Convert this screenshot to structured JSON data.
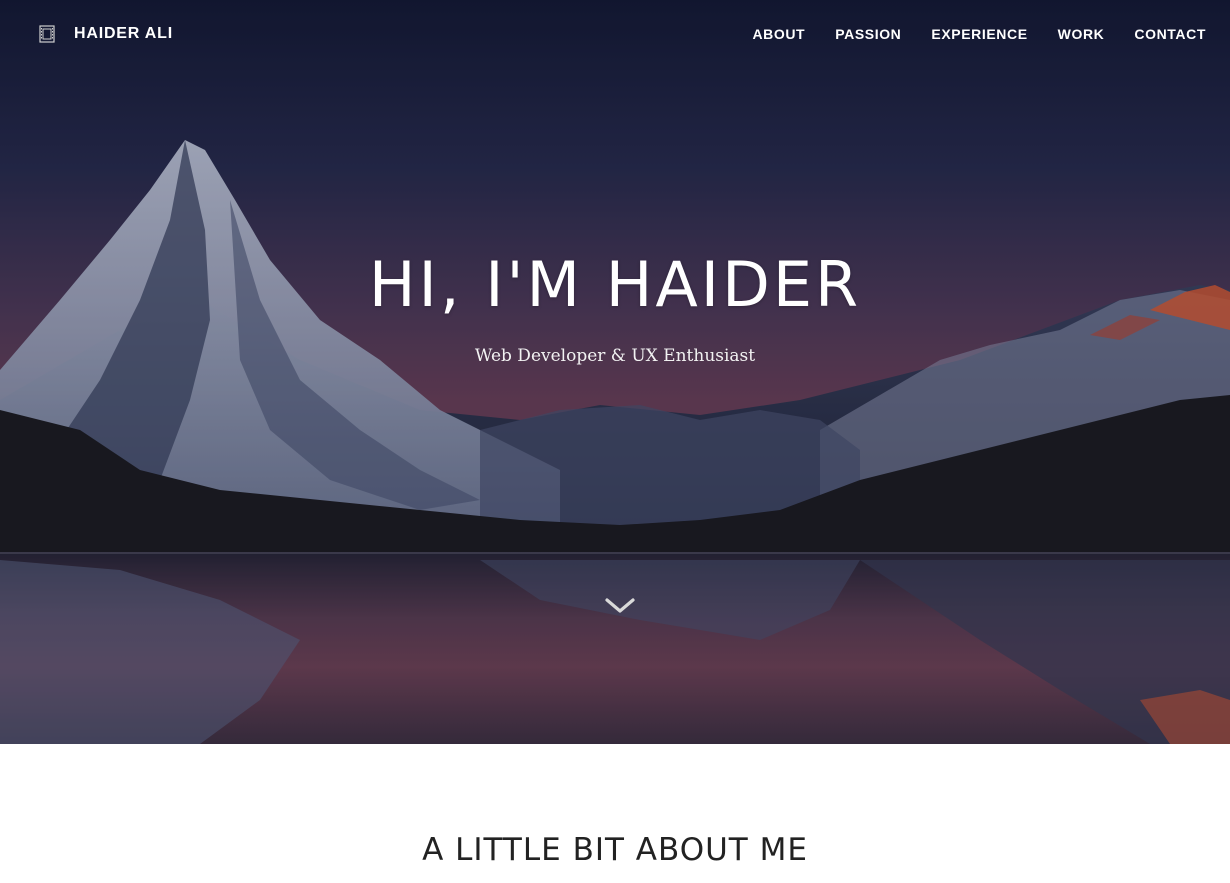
{
  "brand": {
    "name": "HAIDER ALI",
    "logo_icon": "film-strip-icon"
  },
  "nav": {
    "links": [
      {
        "label": "ABOUT"
      },
      {
        "label": "PASSION"
      },
      {
        "label": "EXPERIENCE"
      },
      {
        "label": "WORK"
      },
      {
        "label": "CONTACT"
      }
    ]
  },
  "hero": {
    "title": "HI, I'M HAIDER",
    "subtitle": "Web Developer & UX Enthusiast",
    "scroll_icon": "chevron-down-icon"
  },
  "about": {
    "heading": "A LITTLE BIT ABOUT ME"
  },
  "colors": {
    "text_light": "#ffffff",
    "heading_dark": "#222222",
    "page_bg": "#ffffff"
  }
}
